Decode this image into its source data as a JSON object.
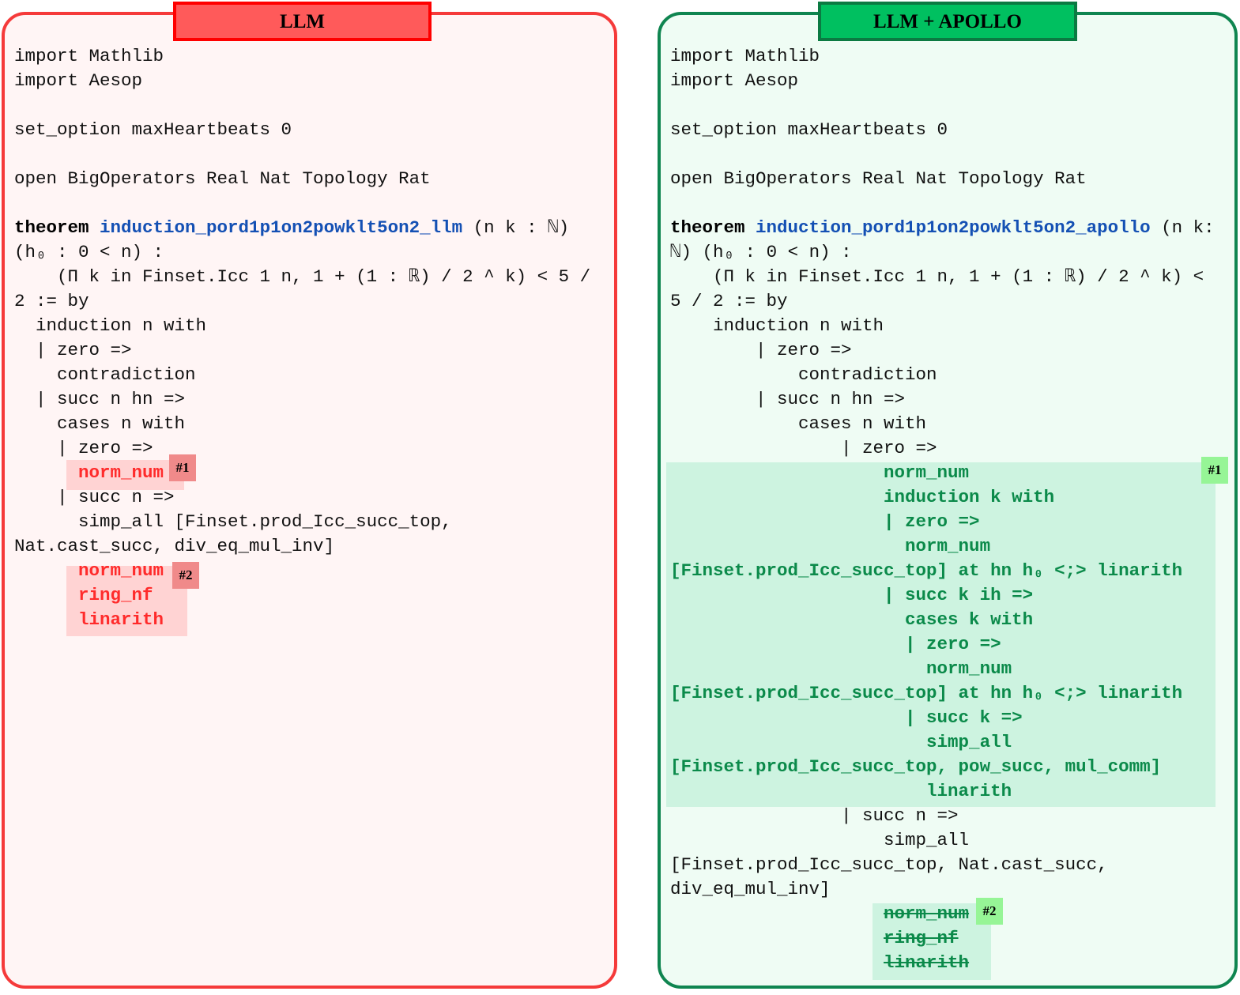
{
  "left": {
    "title": "LLM",
    "badges": [
      "#1",
      "#2"
    ],
    "colors": {
      "border": "#f53a3a",
      "title_fill": "#ff5a5a",
      "highlight": "#ffd3d3",
      "badge": "#f08a8a",
      "error_text": "#ff2b2b"
    },
    "lines": [
      [
        {
          "t": "import Mathlib"
        }
      ],
      [
        {
          "t": "import Aesop"
        }
      ],
      [],
      [
        {
          "t": "set_option maxHeartbeats 0"
        }
      ],
      [],
      [
        {
          "t": "open BigOperators Real Nat Topology Rat"
        }
      ],
      [],
      [
        {
          "t": "theorem",
          "s": "kw"
        },
        {
          "t": " "
        },
        {
          "t": "induction_pord1p1on2powklt5on2_llm",
          "s": "name"
        },
        {
          "t": " (n k : ℕ)"
        }
      ],
      [
        {
          "t": "(h₀ : 0 < n) :"
        }
      ],
      [
        {
          "t": "    (Π k in Finset.Icc 1 n, 1 + (1 : ℝ) / 2 ^ k) < 5 /"
        }
      ],
      [
        {
          "t": "2 := by"
        }
      ],
      [
        {
          "t": "  induction n with"
        }
      ],
      [
        {
          "t": "  | zero =>"
        }
      ],
      [
        {
          "t": "    contradiction"
        }
      ],
      [
        {
          "t": "  | succ n hn =>"
        }
      ],
      [
        {
          "t": "    cases n with"
        }
      ],
      [
        {
          "t": "    | zero =>"
        }
      ],
      [
        {
          "t": "      "
        },
        {
          "t": "norm_num",
          "s": "red"
        }
      ],
      [
        {
          "t": "    | succ n =>"
        }
      ],
      [
        {
          "t": "      simp_all [Finset.prod_Icc_succ_top,"
        }
      ],
      [
        {
          "t": "Nat.cast_succ, div_eq_mul_inv]"
        }
      ],
      [
        {
          "t": "      "
        },
        {
          "t": "norm_num",
          "s": "red"
        }
      ],
      [
        {
          "t": "      "
        },
        {
          "t": "ring_nf",
          "s": "red"
        }
      ],
      [
        {
          "t": "      "
        },
        {
          "t": "linarith",
          "s": "red"
        }
      ]
    ]
  },
  "right": {
    "title": "LLM + APOLLO",
    "badges": [
      "#1",
      "#2"
    ],
    "colors": {
      "border": "#0f8550",
      "title_fill": "#00c060",
      "highlight": "#cdf3e0",
      "badge": "#96f596",
      "fix_text": "#0b8a4a"
    },
    "lines": [
      [
        {
          "t": "import Mathlib"
        }
      ],
      [
        {
          "t": "import Aesop"
        }
      ],
      [],
      [
        {
          "t": "set_option maxHeartbeats 0"
        }
      ],
      [],
      [
        {
          "t": "open BigOperators Real Nat Topology Rat"
        }
      ],
      [],
      [
        {
          "t": "theorem",
          "s": "kw"
        },
        {
          "t": " "
        },
        {
          "t": "induction_pord1p1on2powklt5on2_apollo",
          "s": "name"
        },
        {
          "t": " (n k:"
        }
      ],
      [
        {
          "t": "ℕ) (h₀ : 0 < n) :"
        }
      ],
      [
        {
          "t": "    (Π k in Finset.Icc 1 n, 1 + (1 : ℝ) / 2 ^ k) <"
        }
      ],
      [
        {
          "t": "5 / 2 := by"
        }
      ],
      [
        {
          "t": "    induction n with"
        }
      ],
      [
        {
          "t": "        | zero =>"
        }
      ],
      [
        {
          "t": "            contradiction"
        }
      ],
      [
        {
          "t": "        | succ n hn =>"
        }
      ],
      [
        {
          "t": "            cases n with"
        }
      ],
      [
        {
          "t": "                | zero =>"
        }
      ],
      [
        {
          "t": "                    norm_num",
          "s": "green"
        }
      ],
      [
        {
          "t": "                    induction k with",
          "s": "green"
        }
      ],
      [
        {
          "t": "                    | zero =>",
          "s": "green"
        }
      ],
      [
        {
          "t": "                      norm_num",
          "s": "green"
        }
      ],
      [
        {
          "t": "[Finset.prod_Icc_succ_top] at hn h₀ <;> linarith",
          "s": "green"
        }
      ],
      [
        {
          "t": "                    | succ k ih =>",
          "s": "green"
        }
      ],
      [
        {
          "t": "                      cases k with",
          "s": "green"
        }
      ],
      [
        {
          "t": "                      | zero =>",
          "s": "green"
        }
      ],
      [
        {
          "t": "                        norm_num",
          "s": "green"
        }
      ],
      [
        {
          "t": "[Finset.prod_Icc_succ_top] at hn h₀ <;> linarith",
          "s": "green"
        }
      ],
      [
        {
          "t": "                      | succ k =>",
          "s": "green"
        }
      ],
      [
        {
          "t": "                        simp_all",
          "s": "green"
        }
      ],
      [
        {
          "t": "[Finset.prod_Icc_succ_top, pow_succ, mul_comm]",
          "s": "green"
        }
      ],
      [
        {
          "t": "                        linarith",
          "s": "green"
        }
      ],
      [
        {
          "t": "                | succ n =>"
        }
      ],
      [
        {
          "t": "                    simp_all"
        }
      ],
      [
        {
          "t": "[Finset.prod_Icc_succ_top, Nat.cast_succ,"
        }
      ],
      [
        {
          "t": "div_eq_mul_inv]"
        }
      ],
      [
        {
          "t": "                    "
        },
        {
          "t": "norm_num",
          "s": "strike"
        }
      ],
      [
        {
          "t": "                    "
        },
        {
          "t": "ring_nf",
          "s": "strike"
        }
      ],
      [
        {
          "t": "                    "
        },
        {
          "t": "linarith",
          "s": "strike"
        }
      ]
    ]
  }
}
